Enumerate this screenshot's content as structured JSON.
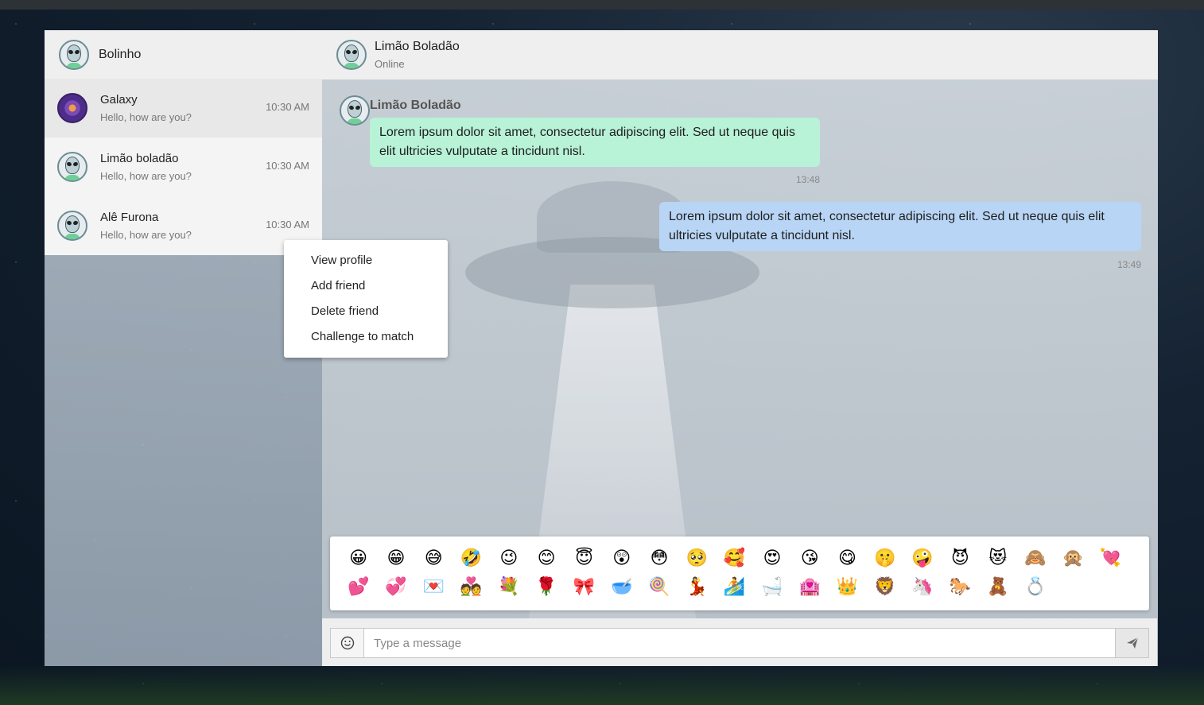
{
  "current_user": {
    "name": "Bolinho"
  },
  "contacts": [
    {
      "name": "Galaxy",
      "preview": "Hello, how are you?",
      "time": "10:30 AM"
    },
    {
      "name": "Limão boladão",
      "preview": "Hello, how are you?",
      "time": "10:30 AM"
    },
    {
      "name": "Alê Furona",
      "preview": "Hello, how are you?",
      "time": "10:30 AM"
    }
  ],
  "chat": {
    "title": "Limão Boladão",
    "status": "Online",
    "messages": [
      {
        "sender": "Limão Boladão",
        "text": "Lorem ipsum dolor sit amet, consectetur adipiscing elit. Sed ut neque quis elit ultricies vulputate a tincidunt nisl.",
        "time": "13:48"
      },
      {
        "text": "Lorem ipsum dolor sit amet, consectetur adipiscing elit. Sed ut neque quis elit ultricies vulputate a tincidunt nisl.",
        "time": "13:49"
      }
    ]
  },
  "context_menu": {
    "items": [
      "View profile",
      "Add friend",
      "Delete friend",
      "Challenge to match"
    ]
  },
  "emoji_picker": {
    "row1": [
      "😀",
      "😁",
      "😅",
      "🤣",
      "😉",
      "😊",
      "😇",
      "😲",
      "😳",
      "🥺",
      "🥰",
      "😍",
      "😘",
      "😋",
      "🤫",
      "🤪",
      "😈",
      "😻",
      "🙈",
      "🙊",
      "💘"
    ],
    "row2": [
      "💕",
      "💞",
      "💌",
      "💑",
      "💐",
      "🌹",
      "🎀",
      "🥣",
      "🍭",
      "💃",
      "🏄",
      "🛁",
      "🏩",
      "👑",
      "🦁",
      "🦄",
      "🐎",
      "🧸",
      "💍"
    ]
  },
  "composer": {
    "placeholder": "Type a message"
  },
  "icons": {
    "emoji_button": "smiley-icon",
    "send_button": "paper-plane-icon"
  },
  "colors": {
    "incoming_bubble": "#b8f2d7",
    "outgoing_bubble": "#b8d5f5"
  }
}
